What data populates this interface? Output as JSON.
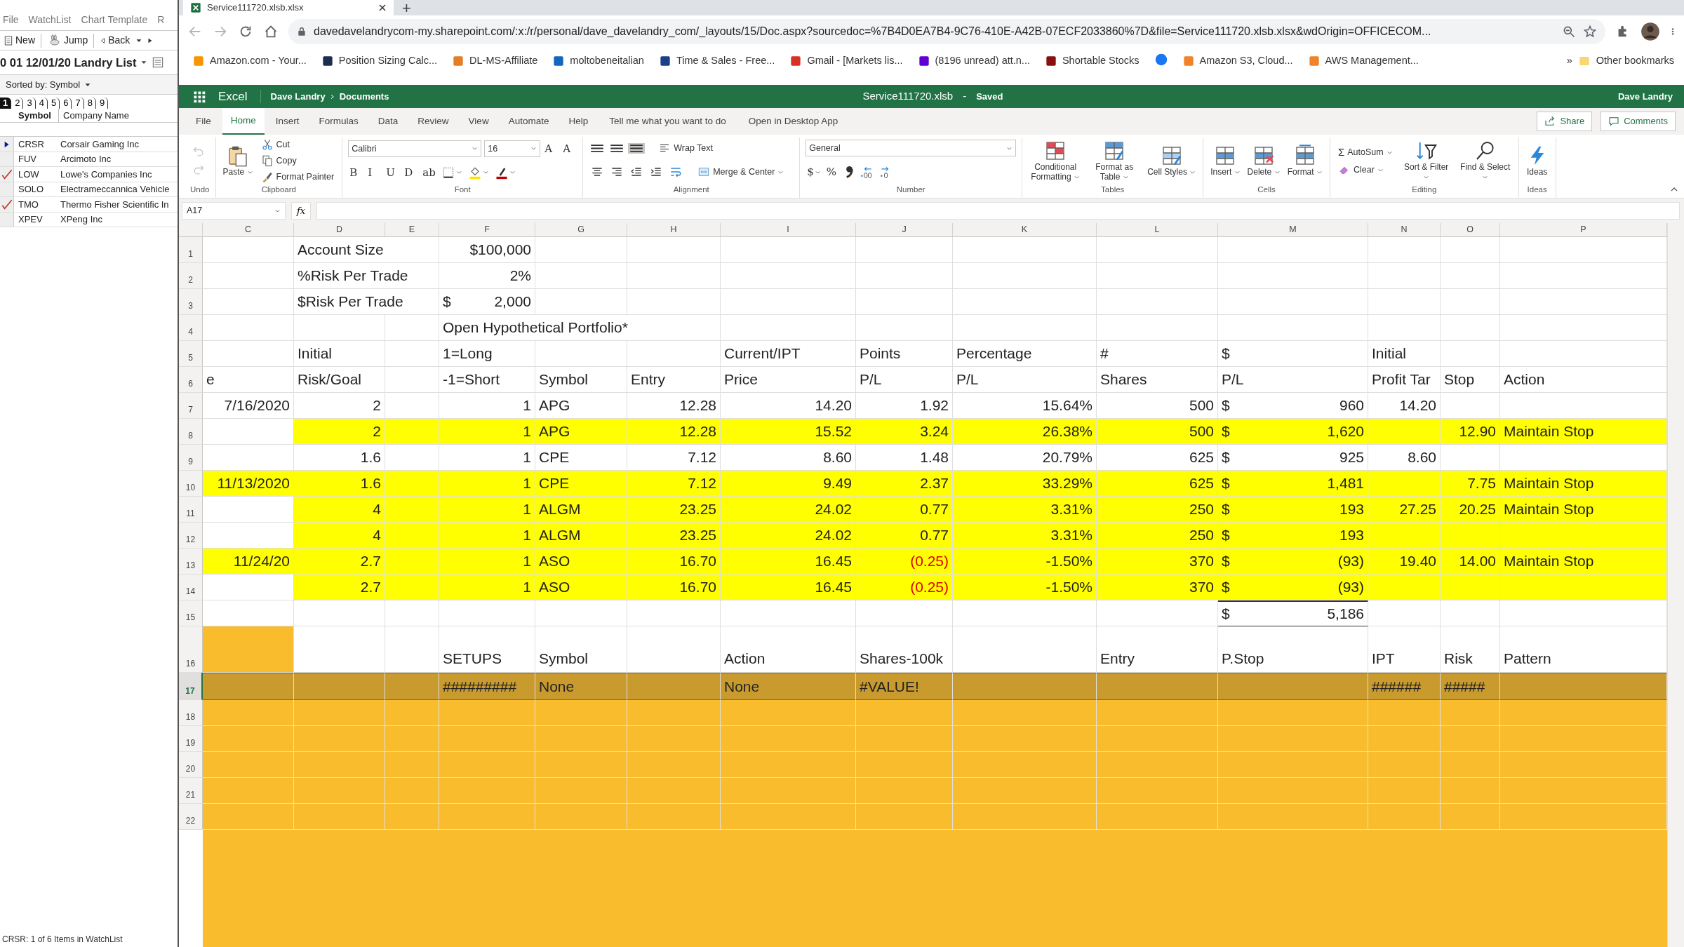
{
  "watchlist": {
    "menu": [
      "File",
      "WatchList",
      "Chart Template",
      "R"
    ],
    "toolbar": [
      {
        "kind": "new",
        "label": "New"
      },
      {
        "kind": "jump",
        "label": "Jump"
      },
      {
        "kind": "back",
        "label": "Back"
      }
    ],
    "list_title": "0 01 12/01/20 Landry List",
    "sort_label": "Sorted by: Symbol",
    "page_tabs": [
      {
        "label": "1",
        "selected": true
      },
      {
        "label": "2",
        "selected": false
      },
      {
        "label": "3",
        "selected": false
      },
      {
        "label": "4",
        "selected": false
      },
      {
        "label": "5",
        "selected": false
      },
      {
        "label": "6",
        "selected": false
      },
      {
        "label": "7",
        "selected": false
      },
      {
        "label": "8",
        "selected": false
      },
      {
        "label": "9",
        "selected": false
      }
    ],
    "columns": [
      "Symbol",
      "Company Name"
    ],
    "items": [
      {
        "symbol": "CRSR",
        "company": "Corsair Gaming Inc",
        "current": true,
        "checked": false
      },
      {
        "symbol": "FUV",
        "company": "Arcimoto Inc",
        "current": false,
        "checked": false
      },
      {
        "symbol": "LOW",
        "company": "Lowe's Companies Inc",
        "current": false,
        "checked": true
      },
      {
        "symbol": "SOLO",
        "company": "Electrameccannica Vehicle",
        "current": false,
        "checked": false
      },
      {
        "symbol": "TMO",
        "company": "Thermo Fisher Scientific In",
        "current": false,
        "checked": true
      },
      {
        "symbol": "XPEV",
        "company": "XPeng Inc",
        "current": false,
        "checked": false
      }
    ],
    "status": "CRSR: 1 of 6 Items in WatchList"
  },
  "browser": {
    "tab_title": "Service111720.xlsb.xlsx",
    "new_tab": "+",
    "url": "davedavelandrycom-my.sharepoint.com/:x:/r/personal/dave_davelandry_com/_layouts/15/Doc.aspx?sourcedoc=%7B4D0EA7B4-9C76-410E-A42B-07ECF2033860%7D&file=Service111720.xlsb.xlsx&wdOrigin=OFFICECOM...",
    "bookmarks": [
      {
        "kind": "link",
        "label": "Amazon.com - Your..."
      },
      {
        "kind": "link",
        "label": "Position Sizing Calc..."
      },
      {
        "kind": "link",
        "label": "DL-MS-Affiliate"
      },
      {
        "kind": "link",
        "label": "moltobeneitalian"
      },
      {
        "kind": "link",
        "label": "Time & Sales - Free..."
      },
      {
        "kind": "link",
        "label": "Gmail - [Markets lis..."
      },
      {
        "kind": "link",
        "label": "(8196 unread) att.n..."
      },
      {
        "kind": "link",
        "label": "Shortable Stocks"
      },
      {
        "kind": "icon"
      },
      {
        "kind": "link",
        "label": "Amazon S3, Cloud..."
      },
      {
        "kind": "link",
        "label": "AWS Management..."
      }
    ],
    "overflow": "»",
    "other_bookmarks": "Other bookmarks"
  },
  "excel": {
    "app": "Excel",
    "breadcrumb": [
      "Dave Landry",
      "Documents"
    ],
    "file_name": "Service111720.xlsb",
    "separator": "-",
    "save_status": "Saved",
    "user": "Dave Landry",
    "ribbon_tabs": [
      {
        "label": "File",
        "selected": false
      },
      {
        "label": "Home",
        "selected": true
      },
      {
        "label": "Insert",
        "selected": false
      },
      {
        "label": "Formulas",
        "selected": false
      },
      {
        "label": "Data",
        "selected": false
      },
      {
        "label": "Review",
        "selected": false
      },
      {
        "label": "View",
        "selected": false
      },
      {
        "label": "Automate",
        "selected": false
      },
      {
        "label": "Help",
        "selected": false
      }
    ],
    "tell_me": "Tell me what you want to do",
    "desktop_app": "Open in Desktop App",
    "share": "Share",
    "comments": "Comments",
    "ribbon_groups": [
      {
        "label": "Undo",
        "columns": [
          [
            {
              "kind": "icon",
              "disabled": true
            },
            {
              "kind": "icon",
              "disabled": true
            }
          ]
        ]
      },
      {
        "label": "Clipboard",
        "columns": [
          [
            {
              "kind": "large",
              "label": "Paste",
              "dropdown": true
            }
          ],
          [
            {
              "kind": "small",
              "label": "Cut"
            },
            {
              "kind": "small",
              "label": "Copy"
            },
            {
              "kind": "small",
              "label": "Format Painter"
            }
          ]
        ]
      },
      {
        "label": "Font",
        "top": [
          {
            "kind": "field",
            "value": "Calibri"
          },
          {
            "kind": "field",
            "value": "16"
          },
          {
            "kind": "glyph",
            "label": "A"
          },
          {
            "kind": "glyph",
            "label": "A"
          }
        ],
        "bottom": [
          {
            "kind": "glyph",
            "label": "B"
          },
          {
            "kind": "glyph",
            "label": "I"
          },
          {
            "kind": "glyph",
            "label": "U"
          },
          {
            "kind": "glyph",
            "label": "D"
          },
          {
            "kind": "glyph",
            "label": "ab"
          },
          {
            "kind": "icon",
            "dropdown": true
          },
          {
            "kind": "icon",
            "dropdown": true
          },
          {
            "kind": "icon",
            "dropdown": true
          }
        ]
      },
      {
        "label": "Alignment",
        "top": [
          {
            "kind": "icon",
            "selected": false
          },
          {
            "kind": "icon",
            "selected": false
          },
          {
            "kind": "icon",
            "selected": true
          },
          {
            "kind": "small",
            "label": "Wrap Text"
          }
        ],
        "bottom": [
          {
            "kind": "icon",
            "selected": false
          },
          {
            "kind": "icon",
            "selected": false
          },
          {
            "kind": "icon",
            "selected": false
          },
          {
            "kind": "icon",
            "selected": false
          },
          {
            "kind": "icon",
            "selected": false
          },
          {
            "kind": "small",
            "label": "Merge & Center",
            "dropdown": true
          }
        ]
      },
      {
        "label": "Number",
        "top": [
          {
            "kind": "field",
            "value": "General"
          }
        ],
        "bottom": [
          {
            "kind": "glyph",
            "label": "$",
            "dropdown": true
          },
          {
            "kind": "glyph",
            "label": "%"
          },
          {
            "kind": "icon"
          },
          {
            "kind": "icon"
          },
          {
            "kind": "icon"
          }
        ]
      },
      {
        "label": "Tables",
        "columns": [
          [
            {
              "kind": "large",
              "label": "Conditional Formatting",
              "dropdown": true
            }
          ],
          [
            {
              "kind": "large",
              "label": "Format as Table",
              "dropdown": true
            }
          ],
          [
            {
              "kind": "large",
              "label": "Cell Styles",
              "dropdown": true
            }
          ]
        ]
      },
      {
        "label": "Cells",
        "columns": [
          [
            {
              "kind": "large",
              "label": "Insert",
              "dropdown": true
            }
          ],
          [
            {
              "kind": "large",
              "label": "Delete",
              "dropdown": true
            }
          ],
          [
            {
              "kind": "large",
              "label": "Format",
              "dropdown": true
            }
          ]
        ]
      },
      {
        "label": "Editing",
        "columns": [
          [
            {
              "kind": "small",
              "glyph": "Σ",
              "label": "AutoSum",
              "dropdown": true
            },
            {
              "kind": "small",
              "label": "Clear",
              "dropdown": true
            }
          ],
          [
            {
              "kind": "large",
              "label": "Sort & Filter",
              "dropdown": true
            }
          ],
          [
            {
              "kind": "large",
              "label": "Find & Select",
              "dropdown": true
            }
          ]
        ]
      },
      {
        "label": "Ideas",
        "columns": [
          [
            {
              "kind": "large",
              "label": "Ideas"
            }
          ]
        ]
      }
    ],
    "name_box": "A17",
    "fx": "fx",
    "sheet": {
      "columns": [
        "C",
        "D",
        "E",
        "F",
        "G",
        "H",
        "I",
        "J",
        "K",
        "L",
        "M",
        "N",
        "O",
        "P"
      ],
      "rows": [
        {
          "number": "1",
          "kind": "normal",
          "selected": false,
          "cells": [
            "",
            {
              "kind": "text",
              "text": "Account Size"
            },
            "",
            {
              "kind": "number",
              "text": "$100,000"
            }
          ]
        },
        {
          "number": "2",
          "kind": "normal",
          "selected": false,
          "cells": [
            "",
            {
              "kind": "text",
              "text": "%Risk Per Trade"
            },
            "",
            {
              "kind": "number",
              "text": "2%"
            }
          ]
        },
        {
          "number": "3",
          "kind": "normal",
          "selected": false,
          "cells": [
            "",
            {
              "kind": "text",
              "text": "$Risk Per Trade"
            },
            "",
            {
              "kind": "currency",
              "currency": "$",
              "text": "2,000"
            }
          ]
        },
        {
          "number": "4",
          "kind": "normal",
          "selected": false,
          "cells": [
            "",
            "",
            "",
            {
              "kind": "text",
              "text": "Open Hypothetical Portfolio*"
            }
          ]
        },
        {
          "number": "5",
          "kind": "normal",
          "selected": false,
          "cells": [
            "",
            {
              "kind": "text",
              "text": "Initial"
            },
            "",
            {
              "kind": "text",
              "text": "1=Long"
            },
            "",
            "",
            {
              "kind": "text",
              "text": "Current/IPT"
            },
            {
              "kind": "text",
              "text": "Points"
            },
            {
              "kind": "text",
              "text": "Percentage"
            },
            {
              "kind": "text",
              "text": "#"
            },
            {
              "kind": "text",
              "text": "$"
            },
            {
              "kind": "text",
              "text": "Initial"
            }
          ]
        },
        {
          "number": "6",
          "kind": "normal",
          "selected": false,
          "cells": [
            {
              "kind": "text",
              "text": "e"
            },
            {
              "kind": "text",
              "text": "Risk/Goal"
            },
            "",
            {
              "kind": "text",
              "text": "-1=Short"
            },
            {
              "kind": "text",
              "text": "Symbol"
            },
            {
              "kind": "text",
              "text": "Entry"
            },
            {
              "kind": "text",
              "text": "Price"
            },
            {
              "kind": "text",
              "text": "P/L"
            },
            {
              "kind": "text",
              "text": "P/L"
            },
            {
              "kind": "text",
              "text": "Shares"
            },
            {
              "kind": "text",
              "text": "P/L"
            },
            {
              "kind": "text",
              "text": "Profit Tar"
            },
            {
              "kind": "text",
              "text": "Stop"
            },
            {
              "kind": "text",
              "text": "Action"
            }
          ]
        },
        {
          "number": "7",
          "kind": "normal",
          "selected": false,
          "cells": [
            {
              "kind": "number",
              "text": "7/16/2020"
            },
            {
              "kind": "number",
              "text": "2"
            },
            "",
            {
              "kind": "number",
              "text": "1"
            },
            {
              "kind": "text",
              "text": "APG"
            },
            {
              "kind": "number",
              "text": "12.28"
            },
            {
              "kind": "number",
              "text": "14.20"
            },
            {
              "kind": "number",
              "text": "1.92"
            },
            {
              "kind": "number",
              "text": "15.64%"
            },
            {
              "kind": "number",
              "text": "500"
            },
            {
              "kind": "currency",
              "currency": "$",
              "text": "960"
            },
            {
              "kind": "number",
              "text": "14.20"
            }
          ]
        },
        {
          "number": "8",
          "kind": "normal",
          "selected": false,
          "cells": [
            "",
            {
              "kind": "number",
              "text": "2",
              "color": "#ffff00"
            },
            {
              "color": "#ffff00"
            },
            {
              "kind": "number",
              "text": "1",
              "color": "#ffff00"
            },
            {
              "kind": "text",
              "text": "APG",
              "color": "#ffff00"
            },
            {
              "kind": "number",
              "text": "12.28",
              "color": "#ffff00"
            },
            {
              "kind": "number",
              "text": "15.52",
              "color": "#ffff00"
            },
            {
              "kind": "number",
              "text": "3.24",
              "color": "#ffff00"
            },
            {
              "kind": "number",
              "text": "26.38%",
              "color": "#ffff00"
            },
            {
              "kind": "number",
              "text": "500",
              "color": "#ffff00"
            },
            {
              "kind": "currency",
              "currency": "$",
              "text": "1,620",
              "color": "#ffff00"
            },
            {
              "color": "#ffff00"
            },
            {
              "kind": "number",
              "text": "12.90",
              "color": "#ffff00"
            },
            {
              "kind": "text",
              "text": "Maintain Stop",
              "color": "#ffff00"
            }
          ]
        },
        {
          "number": "9",
          "kind": "normal",
          "selected": false,
          "cells": [
            "",
            {
              "kind": "number",
              "text": "1.6"
            },
            "",
            {
              "kind": "number",
              "text": "1"
            },
            {
              "kind": "text",
              "text": "CPE"
            },
            {
              "kind": "number",
              "text": "7.12"
            },
            {
              "kind": "number",
              "text": "8.60"
            },
            {
              "kind": "number",
              "text": "1.48"
            },
            {
              "kind": "number",
              "text": "20.79%"
            },
            {
              "kind": "number",
              "text": "625"
            },
            {
              "kind": "currency",
              "currency": "$",
              "text": "925"
            },
            {
              "kind": "number",
              "text": "8.60"
            }
          ]
        },
        {
          "number": "10",
          "kind": "normal",
          "selected": false,
          "cells": [
            {
              "kind": "number",
              "text": "11/13/2020",
              "color": "#ffff00"
            },
            {
              "kind": "number",
              "text": "1.6",
              "color": "#ffff00"
            },
            {
              "color": "#ffff00"
            },
            {
              "kind": "number",
              "text": "1",
              "color": "#ffff00"
            },
            {
              "kind": "text",
              "text": "CPE",
              "color": "#ffff00"
            },
            {
              "kind": "number",
              "text": "7.12",
              "color": "#ffff00"
            },
            {
              "kind": "number",
              "text": "9.49",
              "color": "#ffff00"
            },
            {
              "kind": "number",
              "text": "2.37",
              "color": "#ffff00"
            },
            {
              "kind": "number",
              "text": "33.29%",
              "color": "#ffff00"
            },
            {
              "kind": "number",
              "text": "625",
              "color": "#ffff00"
            },
            {
              "kind": "currency",
              "currency": "$",
              "text": "1,481",
              "color": "#ffff00"
            },
            {
              "color": "#ffff00"
            },
            {
              "kind": "number",
              "text": "7.75",
              "color": "#ffff00"
            },
            {
              "kind": "text",
              "text": "Maintain Stop",
              "color": "#ffff00"
            }
          ]
        },
        {
          "number": "11",
          "kind": "normal",
          "selected": false,
          "cells": [
            "",
            {
              "kind": "number",
              "text": "4",
              "color": "#ffff00"
            },
            {
              "color": "#ffff00"
            },
            {
              "kind": "number",
              "text": "1",
              "color": "#ffff00"
            },
            {
              "kind": "text",
              "text": "ALGM",
              "color": "#ffff00"
            },
            {
              "kind": "number",
              "text": "23.25",
              "color": "#ffff00"
            },
            {
              "kind": "number",
              "text": "24.02",
              "color": "#ffff00"
            },
            {
              "kind": "number",
              "text": "0.77",
              "color": "#ffff00"
            },
            {
              "kind": "number",
              "text": "3.31%",
              "color": "#ffff00"
            },
            {
              "kind": "number",
              "text": "250",
              "color": "#ffff00"
            },
            {
              "kind": "currency",
              "currency": "$",
              "text": "193",
              "color": "#ffff00"
            },
            {
              "kind": "number",
              "text": "27.25",
              "color": "#ffff00"
            },
            {
              "kind": "number",
              "text": "20.25",
              "color": "#ffff00"
            },
            {
              "kind": "text",
              "text": "Maintain Stop",
              "color": "#ffff00"
            }
          ]
        },
        {
          "number": "12",
          "kind": "normal",
          "selected": false,
          "cells": [
            "",
            {
              "kind": "number",
              "text": "4",
              "color": "#ffff00"
            },
            {
              "color": "#ffff00"
            },
            {
              "kind": "number",
              "text": "1",
              "color": "#ffff00"
            },
            {
              "kind": "text",
              "text": "ALGM",
              "color": "#ffff00"
            },
            {
              "kind": "number",
              "text": "23.25",
              "color": "#ffff00"
            },
            {
              "kind": "number",
              "text": "24.02",
              "color": "#ffff00"
            },
            {
              "kind": "number",
              "text": "0.77",
              "color": "#ffff00"
            },
            {
              "kind": "number",
              "text": "3.31%",
              "color": "#ffff00"
            },
            {
              "kind": "number",
              "text": "250",
              "color": "#ffff00"
            },
            {
              "kind": "currency",
              "currency": "$",
              "text": "193",
              "color": "#ffff00"
            },
            {
              "color": "#ffff00"
            },
            {
              "color": "#ffff00"
            },
            {
              "color": "#ffff00"
            }
          ]
        },
        {
          "number": "13",
          "kind": "normal",
          "selected": false,
          "cells": [
            {
              "kind": "number",
              "text": "11/24/20",
              "color": "#ffff00"
            },
            {
              "kind": "number",
              "text": "2.7",
              "color": "#ffff00"
            },
            {
              "color": "#ffff00"
            },
            {
              "kind": "number",
              "text": "1",
              "color": "#ffff00"
            },
            {
              "kind": "text",
              "text": "ASO",
              "color": "#ffff00"
            },
            {
              "kind": "number",
              "text": "16.70",
              "color": "#ffff00"
            },
            {
              "kind": "number",
              "text": "16.45",
              "color": "#ffff00"
            },
            {
              "kind": "negative",
              "text": "(0.25)",
              "color": "#ffff00"
            },
            {
              "kind": "number",
              "text": "-1.50%",
              "color": "#ffff00"
            },
            {
              "kind": "number",
              "text": "370",
              "color": "#ffff00"
            },
            {
              "kind": "currency",
              "currency": "$",
              "text": "(93)",
              "color": "#ffff00"
            },
            {
              "kind": "number",
              "text": "19.40",
              "color": "#ffff00"
            },
            {
              "kind": "number",
              "text": "14.00",
              "color": "#ffff00"
            },
            {
              "kind": "text",
              "text": "Maintain Stop",
              "color": "#ffff00"
            }
          ]
        },
        {
          "number": "14",
          "kind": "normal",
          "selected": false,
          "cells": [
            "",
            {
              "kind": "number",
              "text": "2.7",
              "color": "#ffff00"
            },
            {
              "color": "#ffff00"
            },
            {
              "kind": "number",
              "text": "1",
              "color": "#ffff00"
            },
            {
              "kind": "text",
              "text": "ASO",
              "color": "#ffff00"
            },
            {
              "kind": "number",
              "text": "16.70",
              "color": "#ffff00"
            },
            {
              "kind": "number",
              "text": "16.45",
              "color": "#ffff00"
            },
            {
              "kind": "negative",
              "text": "(0.25)",
              "color": "#ffff00"
            },
            {
              "kind": "number",
              "text": "-1.50%",
              "color": "#ffff00"
            },
            {
              "kind": "number",
              "text": "370",
              "color": "#ffff00"
            },
            {
              "kind": "currency",
              "currency": "$",
              "text": "(93)",
              "color": "#ffff00"
            },
            {
              "color": "#ffff00"
            },
            {
              "color": "#ffff00"
            },
            {
              "color": "#ffff00"
            }
          ]
        },
        {
          "number": "15",
          "kind": "normal",
          "selected": false,
          "cells": [
            "",
            "",
            "",
            "",
            "",
            "",
            "",
            "",
            "",
            "",
            {
              "kind": "total",
              "currency": "$",
              "text": "5,186"
            }
          ]
        },
        {
          "number": "16",
          "kind": "tall",
          "selected": false,
          "cells": [
            {
              "color": "#f9bc2c"
            },
            "",
            "",
            {
              "kind": "text",
              "text": "SETUPS"
            },
            {
              "kind": "text",
              "text": "Symbol"
            },
            "",
            {
              "kind": "text",
              "text": "Action"
            },
            {
              "kind": "text",
              "text": "Shares-100k"
            },
            "",
            {
              "kind": "text",
              "text": "Entry"
            },
            {
              "kind": "text",
              "text": "P.Stop"
            },
            {
              "kind": "text",
              "text": "IPT"
            },
            {
              "kind": "text",
              "text": "Risk"
            },
            {
              "kind": "text",
              "text": "Pattern"
            }
          ]
        },
        {
          "number": "17",
          "kind": "normal",
          "selected": true,
          "cells": [
            {
              "color": "#c99a2e"
            },
            {
              "color": "#c99a2e"
            },
            {
              "color": "#c99a2e"
            },
            {
              "kind": "text",
              "text": "#########",
              "color": "#c99a2e"
            },
            {
              "kind": "text",
              "text": "None",
              "color": "#c99a2e"
            },
            {
              "color": "#c99a2e"
            },
            {
              "kind": "text",
              "text": "None",
              "color": "#c99a2e"
            },
            {
              "kind": "text",
              "text": "#VALUE!",
              "color": "#c99a2e"
            },
            {
              "color": "#c99a2e"
            },
            {
              "color": "#c99a2e"
            },
            {
              "color": "#c99a2e"
            },
            {
              "kind": "text",
              "text": "######",
              "color": "#c99a2e"
            },
            {
              "kind": "text",
              "text": "#####",
              "color": "#c99a2e"
            },
            {
              "color": "#c99a2e"
            }
          ]
        },
        {
          "number": "18",
          "kind": "normal",
          "selected": false,
          "cells": [
            {
              "color": "#f9bc2c"
            },
            {
              "color": "#f9bc2c"
            },
            {
              "color": "#f9bc2c"
            },
            {
              "color": "#f9bc2c"
            },
            {
              "color": "#f9bc2c"
            },
            {
              "color": "#f9bc2c"
            },
            {
              "color": "#f9bc2c"
            },
            {
              "color": "#f9bc2c"
            },
            {
              "color": "#f9bc2c"
            },
            {
              "color": "#f9bc2c"
            },
            {
              "color": "#f9bc2c"
            },
            {
              "color": "#f9bc2c"
            },
            {
              "color": "#f9bc2c"
            },
            {
              "color": "#f9bc2c"
            }
          ]
        },
        {
          "number": "19",
          "kind": "normal",
          "selected": false,
          "cells": [
            {
              "color": "#f9bc2c"
            },
            {
              "color": "#f9bc2c"
            },
            {
              "color": "#f9bc2c"
            },
            {
              "color": "#f9bc2c"
            },
            {
              "color": "#f9bc2c"
            },
            {
              "color": "#f9bc2c"
            },
            {
              "color": "#f9bc2c"
            },
            {
              "color": "#f9bc2c"
            },
            {
              "color": "#f9bc2c"
            },
            {
              "color": "#f9bc2c"
            },
            {
              "color": "#f9bc2c"
            },
            {
              "color": "#f9bc2c"
            },
            {
              "color": "#f9bc2c"
            },
            {
              "color": "#f9bc2c"
            }
          ]
        },
        {
          "number": "20",
          "kind": "normal",
          "selected": false,
          "cells": [
            {
              "color": "#f9bc2c"
            },
            {
              "color": "#f9bc2c"
            },
            {
              "color": "#f9bc2c"
            },
            {
              "color": "#f9bc2c"
            },
            {
              "color": "#f9bc2c"
            },
            {
              "color": "#f9bc2c"
            },
            {
              "color": "#f9bc2c"
            },
            {
              "color": "#f9bc2c"
            },
            {
              "color": "#f9bc2c"
            },
            {
              "color": "#f9bc2c"
            },
            {
              "color": "#f9bc2c"
            },
            {
              "color": "#f9bc2c"
            },
            {
              "color": "#f9bc2c"
            },
            {
              "color": "#f9bc2c"
            }
          ]
        },
        {
          "number": "21",
          "kind": "normal",
          "selected": false,
          "cells": [
            {
              "color": "#f9bc2c"
            },
            {
              "color": "#f9bc2c"
            },
            {
              "color": "#f9bc2c"
            },
            {
              "color": "#f9bc2c"
            },
            {
              "color": "#f9bc2c"
            },
            {
              "color": "#f9bc2c"
            },
            {
              "color": "#f9bc2c"
            },
            {
              "color": "#f9bc2c"
            },
            {
              "color": "#f9bc2c"
            },
            {
              "color": "#f9bc2c"
            },
            {
              "color": "#f9bc2c"
            },
            {
              "color": "#f9bc2c"
            },
            {
              "color": "#f9bc2c"
            },
            {
              "color": "#f9bc2c"
            }
          ]
        },
        {
          "number": "22",
          "kind": "normal",
          "selected": false,
          "cells": [
            {
              "color": "#f9bc2c"
            },
            {
              "color": "#f9bc2c"
            },
            {
              "color": "#f9bc2c"
            },
            {
              "color": "#f9bc2c"
            },
            {
              "color": "#f9bc2c"
            },
            {
              "color": "#f9bc2c"
            },
            {
              "color": "#f9bc2c"
            },
            {
              "color": "#f9bc2c"
            },
            {
              "color": "#f9bc2c"
            },
            {
              "color": "#f9bc2c"
            },
            {
              "color": "#f9bc2c"
            },
            {
              "color": "#f9bc2c"
            },
            {
              "color": "#f9bc2c"
            },
            {
              "color": "#f9bc2c"
            }
          ]
        }
      ]
    }
  }
}
